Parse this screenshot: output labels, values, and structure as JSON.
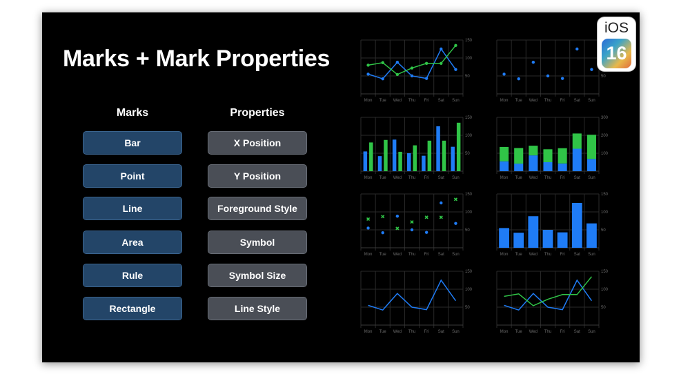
{
  "slide": {
    "title": "Marks + Mark Properties",
    "marks_header": "Marks",
    "properties_header": "Properties",
    "marks": [
      "Bar",
      "Point",
      "Line",
      "Area",
      "Rule",
      "Rectangle"
    ],
    "properties": [
      "X Position",
      "Y Position",
      "Foreground Style",
      "Symbol",
      "Symbol Size",
      "Line Style"
    ]
  },
  "badge": {
    "os": "iOS",
    "version": "16"
  },
  "colors": {
    "blue": "#1f7cf6",
    "green": "#30c447",
    "grid": "#2a2a2a",
    "tick": "#6b6b6b"
  },
  "chart_data": [
    {
      "type": "line",
      "categories": [
        "Mon",
        "Tue",
        "Wed",
        "Thu",
        "Fri",
        "Sat",
        "Sun"
      ],
      "ylim": [
        0,
        150
      ],
      "yticks": [
        50,
        100,
        150
      ],
      "series": [
        {
          "values": [
            55,
            42,
            88,
            50,
            43,
            125,
            68
          ],
          "marker": "circle"
        },
        {
          "values": [
            80,
            87,
            54,
            72,
            85,
            85,
            135
          ],
          "marker": "circle"
        }
      ]
    },
    {
      "type": "scatter",
      "categories": [
        "Mon",
        "Tue",
        "Wed",
        "Thu",
        "Fri",
        "Sat",
        "Sun"
      ],
      "ylim": [
        0,
        150
      ],
      "yticks": [
        50,
        100,
        150
      ],
      "series": [
        {
          "values": [
            55,
            42,
            88,
            50,
            43,
            125,
            68
          ],
          "marker": "circle"
        }
      ]
    },
    {
      "type": "bar",
      "categories": [
        "Mon",
        "Tue",
        "Wed",
        "Thu",
        "Fri",
        "Sat",
        "Sun"
      ],
      "ylim": [
        0,
        150
      ],
      "yticks": [
        50,
        100,
        150
      ],
      "series": [
        {
          "values": [
            55,
            42,
            88,
            50,
            43,
            125,
            68
          ]
        },
        {
          "values": [
            80,
            87,
            54,
            72,
            85,
            85,
            135
          ]
        }
      ]
    },
    {
      "type": "bar",
      "stacked": true,
      "categories": [
        "Mon",
        "Tue",
        "Wed",
        "Thu",
        "Fri",
        "Sat",
        "Sun"
      ],
      "ylim": [
        0,
        300
      ],
      "yticks": [
        100,
        200,
        300
      ],
      "series": [
        {
          "values": [
            55,
            42,
            88,
            50,
            43,
            125,
            68
          ]
        },
        {
          "values": [
            80,
            87,
            54,
            72,
            85,
            85,
            135
          ]
        }
      ]
    },
    {
      "type": "scatter",
      "categories": [
        "Mon",
        "Tue",
        "Wed",
        "Thu",
        "Fri",
        "Sat",
        "Sun"
      ],
      "ylim": [
        0,
        150
      ],
      "yticks": [
        50,
        100,
        150
      ],
      "series": [
        {
          "values": [
            55,
            42,
            88,
            50,
            43,
            125,
            68
          ],
          "marker": "circle"
        },
        {
          "values": [
            80,
            87,
            54,
            72,
            85,
            85,
            135
          ],
          "marker": "square-cross"
        }
      ]
    },
    {
      "type": "bar",
      "categories": [
        "Mon",
        "Tue",
        "Wed",
        "Thu",
        "Fri",
        "Sat",
        "Sun"
      ],
      "ylim": [
        0,
        150
      ],
      "yticks": [
        50,
        100,
        150
      ],
      "series": [
        {
          "values": [
            55,
            42,
            88,
            50,
            43,
            125,
            68
          ]
        }
      ]
    },
    {
      "type": "line",
      "categories": [
        "Mon",
        "Tue",
        "Wed",
        "Thu",
        "Fri",
        "Sat",
        "Sun"
      ],
      "ylim": [
        0,
        150
      ],
      "yticks": [
        50,
        100,
        150
      ],
      "series": [
        {
          "values": [
            55,
            42,
            88,
            50,
            43,
            125,
            68
          ]
        }
      ]
    },
    {
      "type": "line",
      "categories": [
        "Mon",
        "Tue",
        "Wed",
        "Thu",
        "Fri",
        "Sat",
        "Sun"
      ],
      "ylim": [
        0,
        150
      ],
      "yticks": [
        50,
        100,
        150
      ],
      "series": [
        {
          "values": [
            55,
            42,
            88,
            50,
            43,
            125,
            68
          ]
        },
        {
          "values": [
            80,
            87,
            54,
            72,
            85,
            85,
            135
          ]
        }
      ]
    }
  ]
}
